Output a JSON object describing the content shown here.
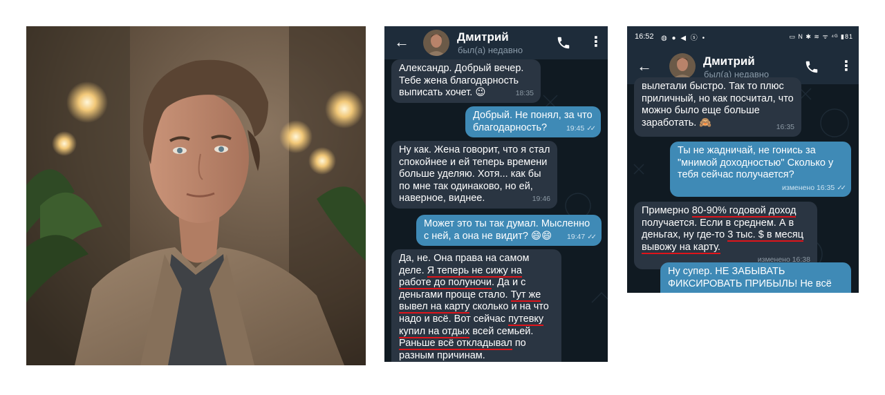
{
  "contact": {
    "name": "Дмитрий",
    "status": "был(а) недавно"
  },
  "statusbar": {
    "time": "16:52",
    "left_icons": "◍ ● ◀ ⓢ •",
    "right_icons": "▭ N ✱ ≋ ᯤ ⁴ᴳ ▮81"
  },
  "chat1": [
    {
      "dir": "in",
      "text": "Александр. Добрый вечер. Тебе жена благодарность выписать хочет. 😉",
      "time": "18:35"
    },
    {
      "dir": "out",
      "text": "Добрый. Не понял, за что благодарность?",
      "time": "19:45"
    },
    {
      "dir": "in",
      "text": "Ну как. Жена говорит, что я стал спокойнее и ей теперь времени больше уделяю. Хотя... как бы по мне так одинаково, но ей, наверное, виднее.",
      "time": "19:46"
    },
    {
      "dir": "out",
      "text": "Может это ты так думал. Мысленно с ней, а она не видит? 😄😄",
      "time": "19:47"
    },
    {
      "dir": "in",
      "parts": [
        "Да, не. Она права на самом деле. ",
        {
          "u": "Я теперь не сижу на работе до полуночи"
        },
        ". Да и с деньгами проще стало. ",
        {
          "u": "Тут же вывел на карту"
        },
        " сколько и на что надо и всё. Вот сейчас ",
        {
          "u": "путевку купил на отдых"
        },
        " всей семьей. ",
        {
          "u": "Раньше всё откладывал"
        },
        " по разным причинам."
      ],
      "time": "19:49"
    }
  ],
  "chat2": [
    {
      "dir": "in",
      "text": "вылетали быстро. Так то плюс приличный, но как посчитал, что можно было еще больше заработать. 🙈",
      "time": "16:35"
    },
    {
      "dir": "out",
      "text": "Ты не жадничай, не гонись за \"мнимой доходностью\" Сколько у тебя сейчас получается?",
      "time": "изменено 16:35"
    },
    {
      "dir": "in",
      "parts": [
        "Примерно ",
        {
          "u": "80-90% годовой доход"
        },
        " получается. Если в среднем. А в деньгах, ну где-то ",
        {
          "u": "3 тыс. $ в месяц вывожу на карту."
        }
      ],
      "time": "изменено 16:38"
    },
    {
      "dir": "out",
      "text": "Ну супер. НЕ ЗАБЫВАТЬ ФИКСИРОВАТЬ ПРИБЫЛЬ! Не всё",
      "time": ""
    }
  ],
  "colors": {
    "incoming_bubble": "#2a3542",
    "outgoing_bubble": "#3f8ab6",
    "header": "#1e2c3a",
    "chat_background": "#101a22",
    "underline": "#e0141a"
  },
  "icons": [
    "back-arrow-icon",
    "phone-icon",
    "more-vert-icon",
    "double-check-icon"
  ]
}
